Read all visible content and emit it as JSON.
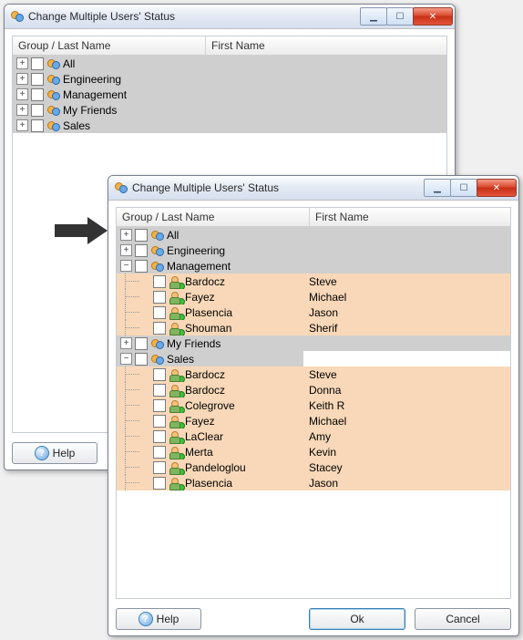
{
  "window_back": {
    "title": "Change Multiple Users' Status",
    "columns": {
      "c1": "Group / Last Name",
      "c2": "First Name"
    },
    "col1_width": 205,
    "groups": [
      {
        "label": "All",
        "expanded": false
      },
      {
        "label": "Engineering",
        "expanded": false
      },
      {
        "label": "Management",
        "expanded": false
      },
      {
        "label": "My Friends",
        "expanded": false
      },
      {
        "label": "Sales",
        "expanded": false
      }
    ],
    "help_label": "Help"
  },
  "window_front": {
    "title": "Change Multiple Users' Status",
    "columns": {
      "c1": "Group / Last Name",
      "c2": "First Name"
    },
    "col1_width": 205,
    "help_label": "Help",
    "ok_label": "Ok",
    "cancel_label": "Cancel",
    "rows": [
      {
        "type": "group",
        "label": "All",
        "toggle": "+",
        "bg": "group"
      },
      {
        "type": "group",
        "label": "Engineering",
        "toggle": "+",
        "bg": "group"
      },
      {
        "type": "group",
        "label": "Management",
        "toggle": "−",
        "bg": "group"
      },
      {
        "type": "person",
        "last": "Bardocz",
        "first": "Steve",
        "bg": "person"
      },
      {
        "type": "person",
        "last": "Fayez",
        "first": "Michael",
        "bg": "person"
      },
      {
        "type": "person",
        "last": "Plasencia",
        "first": "Jason",
        "bg": "person"
      },
      {
        "type": "person",
        "last": "Shouman",
        "first": "Sherif",
        "bg": "person"
      },
      {
        "type": "group",
        "label": "My Friends",
        "toggle": "+",
        "bg": "group"
      },
      {
        "type": "group",
        "label": "Sales",
        "toggle": "−",
        "bg": "group",
        "half": true
      },
      {
        "type": "person",
        "last": "Bardocz",
        "first": "Steve",
        "bg": "person"
      },
      {
        "type": "person",
        "last": "Bardocz",
        "first": "Donna",
        "bg": "person"
      },
      {
        "type": "person",
        "last": "Colegrove",
        "first": "Keith R",
        "bg": "person"
      },
      {
        "type": "person",
        "last": "Fayez",
        "first": "Michael",
        "bg": "person"
      },
      {
        "type": "person",
        "last": "LaClear",
        "first": "Amy",
        "bg": "person"
      },
      {
        "type": "person",
        "last": "Merta",
        "first": "Kevin",
        "bg": "person"
      },
      {
        "type": "person",
        "last": "Pandeloglou",
        "first": "Stacey",
        "bg": "person"
      },
      {
        "type": "person",
        "last": "Plasencia",
        "first": "Jason",
        "bg": "person"
      }
    ]
  }
}
